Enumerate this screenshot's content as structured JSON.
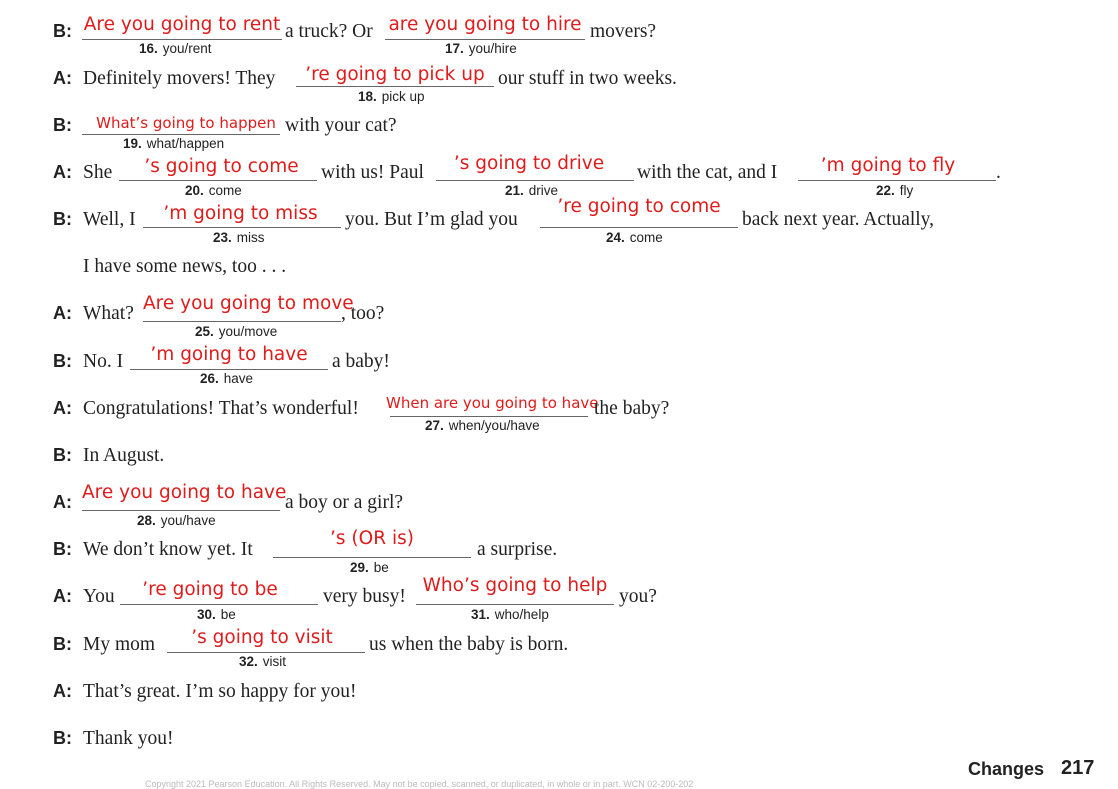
{
  "lines": [
    {
      "speaker": "B:"
    },
    {
      "speaker": "A:",
      "text1": "Definitely movers! They",
      "text2": "our stuff in two weeks."
    },
    {
      "speaker": "B:",
      "text1": "with your cat?"
    },
    {
      "speaker": "A:",
      "text1": "She",
      "text2": "with us! Paul",
      "text3": "with the cat, and I",
      "text4": "."
    },
    {
      "speaker": "B:",
      "text1": "Well, I",
      "text2": "you. But I’m glad you",
      "text3": "back next year. Actually,"
    },
    {
      "text1": "I have some news, too . . ."
    },
    {
      "speaker": "A:",
      "text1": "What?",
      "text2": ", too?"
    },
    {
      "speaker": "B:",
      "text1": "No. I",
      "text2": "a baby!"
    },
    {
      "speaker": "A:",
      "text1": "Congratulations! That’s wonderful!",
      "text2": "the baby?"
    },
    {
      "speaker": "B:",
      "text1": "In August."
    },
    {
      "speaker": "A:",
      "text1": "a boy or a girl?"
    },
    {
      "speaker": "B:",
      "text1": "We don’t know yet. It",
      "text2": "a surprise."
    },
    {
      "speaker": "A:",
      "text1": "You",
      "text2": "very busy!",
      "text3": "you?"
    },
    {
      "speaker": "B:",
      "text1": "My mom",
      "text2": "us when the baby is born."
    },
    {
      "speaker": "A:",
      "text1": "That’s great. I’m so happy for you!"
    },
    {
      "speaker": "B:",
      "text1": "Thank you!"
    }
  ],
  "line0": {
    "text1": "a truck? Or",
    "text2": "movers?"
  },
  "items": [
    {
      "num": "16.",
      "cue": "you/rent",
      "answer": "Are you going to rent"
    },
    {
      "num": "17.",
      "cue": "you/hire",
      "answer": "are you going to hire"
    },
    {
      "num": "18.",
      "cue": "pick up",
      "answer": "’re going to pick up"
    },
    {
      "num": "19.",
      "cue": "what/happen",
      "answer": "What’s going to happen"
    },
    {
      "num": "20.",
      "cue": "come",
      "answer": "’s going to come"
    },
    {
      "num": "21.",
      "cue": "drive",
      "answer": "’s going to drive"
    },
    {
      "num": "22.",
      "cue": "fly",
      "answer": "’m going to fly"
    },
    {
      "num": "23.",
      "cue": "miss",
      "answer": "’m going to miss"
    },
    {
      "num": "24.",
      "cue": "come",
      "answer": "’re going to come"
    },
    {
      "num": "25.",
      "cue": "you/move",
      "answer": "Are you going to move"
    },
    {
      "num": "26.",
      "cue": "have",
      "answer": "’m going to have"
    },
    {
      "num": "27.",
      "cue": "when/you/have",
      "answer": "When are you going to have"
    },
    {
      "num": "28.",
      "cue": "you/have",
      "answer": "Are you going to have"
    },
    {
      "num": "29.",
      "cue": "be",
      "answer": "’s (OR is)"
    },
    {
      "num": "30.",
      "cue": "be",
      "answer": "’re going to be"
    },
    {
      "num": "31.",
      "cue": "who/help",
      "answer": "Who’s going to help"
    },
    {
      "num": "32.",
      "cue": "visit",
      "answer": "’s going to visit"
    }
  ],
  "footer": {
    "section": "Changes",
    "page": "217"
  },
  "copyright": "Copyright 2021 Pearson Education. All Rights Reserved. May not be copied, scanned, or duplicated, in whole or in part. WCN 02-200-202"
}
